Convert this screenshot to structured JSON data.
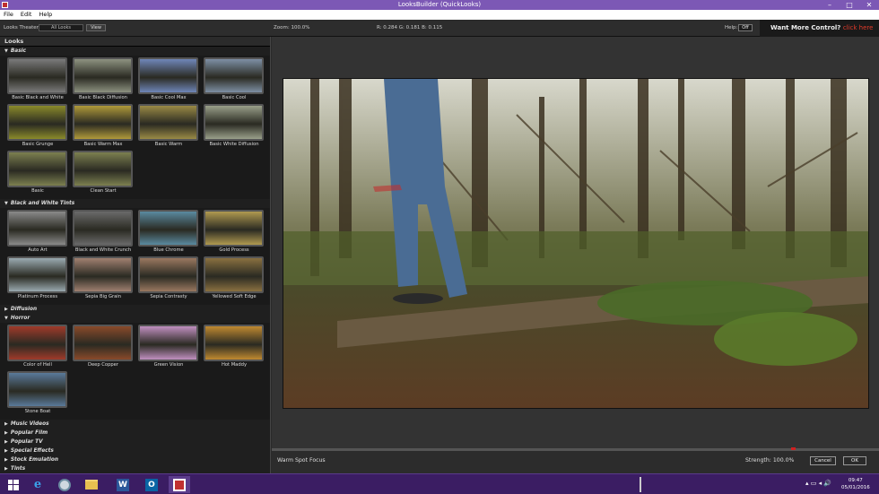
{
  "window": {
    "title": "LooksBuilder (QuickLooks)",
    "minimize": "–",
    "maximize": "□",
    "close": "✕"
  },
  "menu": [
    "File",
    "Edit",
    "Help"
  ],
  "toolbar": {
    "looks_theater_label": "Looks Theater:",
    "looks_theater_value": "All Looks",
    "view_label": "View",
    "zoom": "Zoom:  100.0%",
    "rgb": "R: 0.284    G: 0.181    B: 0.115",
    "help_label": "Help:",
    "help_value": "Off",
    "promo_text": "Want More Control?",
    "promo_link": "click here"
  },
  "panel": {
    "title": "Looks",
    "sections": [
      {
        "name": "Basic",
        "expanded": true,
        "items": [
          {
            "label": "Basic Black and White",
            "tint": "#7a7a7a"
          },
          {
            "label": "Basic Black Diffusion",
            "tint": "#8d9280"
          },
          {
            "label": "Basic Cool Max",
            "tint": "#6f86b8"
          },
          {
            "label": "Basic Cool",
            "tint": "#7d8fa4"
          },
          {
            "label": "Basic Grunge",
            "tint": "#8a8a2a"
          },
          {
            "label": "Basic Warm Max",
            "tint": "#b09a3a"
          },
          {
            "label": "Basic Warm",
            "tint": "#9a8a45"
          },
          {
            "label": "Basic White Diffusion",
            "tint": "#9aa08a"
          },
          {
            "label": "Basic",
            "tint": "#7c8050"
          },
          {
            "label": "Clean Start",
            "tint": "#7c8050"
          }
        ]
      },
      {
        "name": "Black and White Tints",
        "expanded": true,
        "items": [
          {
            "label": "Auto Art",
            "tint": "#8a8a8a"
          },
          {
            "label": "Black and White Crunch",
            "tint": "#6a6a6a"
          },
          {
            "label": "Blue Chrome",
            "tint": "#5a8aa0"
          },
          {
            "label": "Gold Process",
            "tint": "#b09a50"
          },
          {
            "label": "Platinum Process",
            "tint": "#9aaab0"
          },
          {
            "label": "Sepia Big Grain",
            "tint": "#a08070"
          },
          {
            "label": "Sepia Contrasty",
            "tint": "#9a7860"
          },
          {
            "label": "Yellowed Soft Edge",
            "tint": "#8a7040"
          }
        ]
      },
      {
        "name": "Diffusion",
        "expanded": false,
        "items": []
      },
      {
        "name": "Horror",
        "expanded": true,
        "items": [
          {
            "label": "Color of Hell",
            "tint": "#a03a2a"
          },
          {
            "label": "Deep Copper",
            "tint": "#8a4a2a"
          },
          {
            "label": "Green Vision",
            "tint": "#c090c0"
          },
          {
            "label": "Hot Maddy",
            "tint": "#c08a30"
          },
          {
            "label": "Stone Boat",
            "tint": "#5a7a9a"
          }
        ]
      },
      {
        "name": "Music Videos",
        "expanded": false,
        "items": []
      },
      {
        "name": "Popular Film",
        "expanded": false,
        "items": []
      },
      {
        "name": "Popular TV",
        "expanded": false,
        "items": []
      },
      {
        "name": "Special Effects",
        "expanded": false,
        "items": []
      },
      {
        "name": "Stock Emulation",
        "expanded": false,
        "items": []
      },
      {
        "name": "Tints",
        "expanded": false,
        "items": []
      }
    ]
  },
  "status": {
    "look_name": "Warm Spot Focus",
    "strength": "Strength:  100.0%",
    "strength_value": 1.0,
    "cancel": "Cancel",
    "ok": "OK"
  },
  "taskbar": {
    "time": "09:47",
    "date": "05/01/2016"
  },
  "colors": {
    "title_bar": "#7c58b5",
    "taskbar": "#3b1d63",
    "promo_link": "#e23a2a"
  }
}
